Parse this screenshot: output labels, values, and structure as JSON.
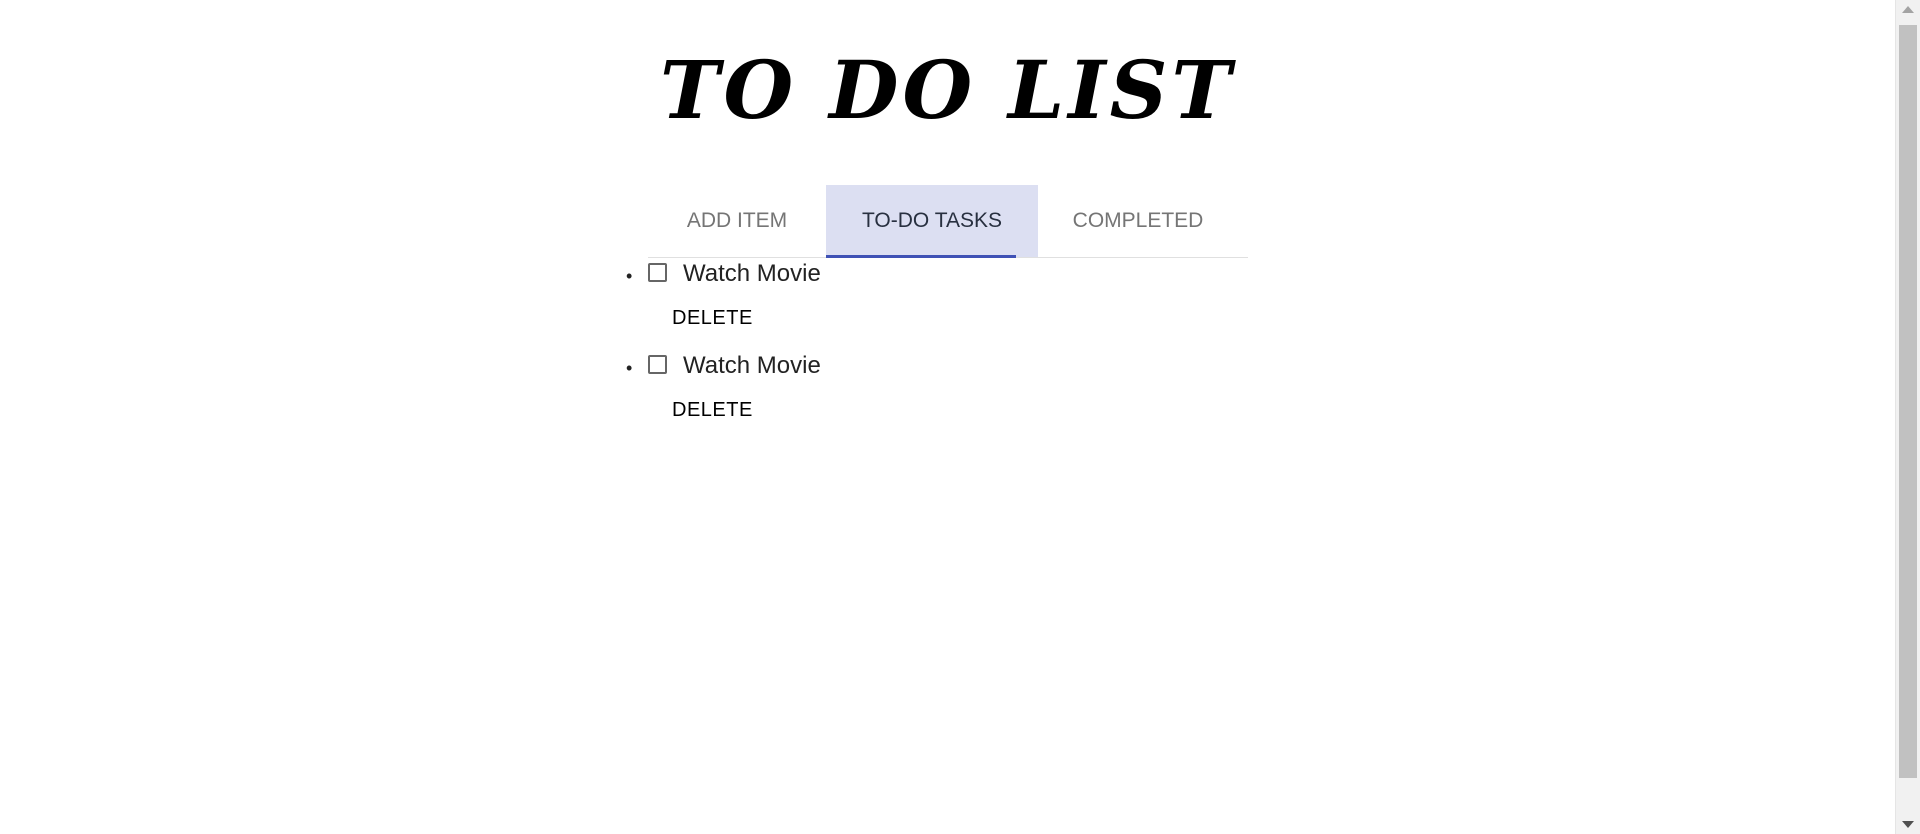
{
  "title": "TO DO LIST",
  "tabs": [
    {
      "label": "ADD ITEM",
      "active": false
    },
    {
      "label": "TO-DO TASKS",
      "active": true
    },
    {
      "label": "COMPLETED",
      "active": false
    }
  ],
  "tasks": [
    {
      "label": "Watch Movie",
      "checked": false,
      "delete_label": "DELETE"
    },
    {
      "label": "Watch Movie",
      "checked": false,
      "delete_label": "DELETE"
    }
  ],
  "colors": {
    "active_tab_bg": "#dcdff2",
    "active_indicator": "#3f51b5",
    "inactive_tab_text": "#757575",
    "active_tab_text": "#283040"
  },
  "icons": {
    "bullet": "bullet-icon",
    "checkbox": "checkbox-unchecked-icon"
  }
}
